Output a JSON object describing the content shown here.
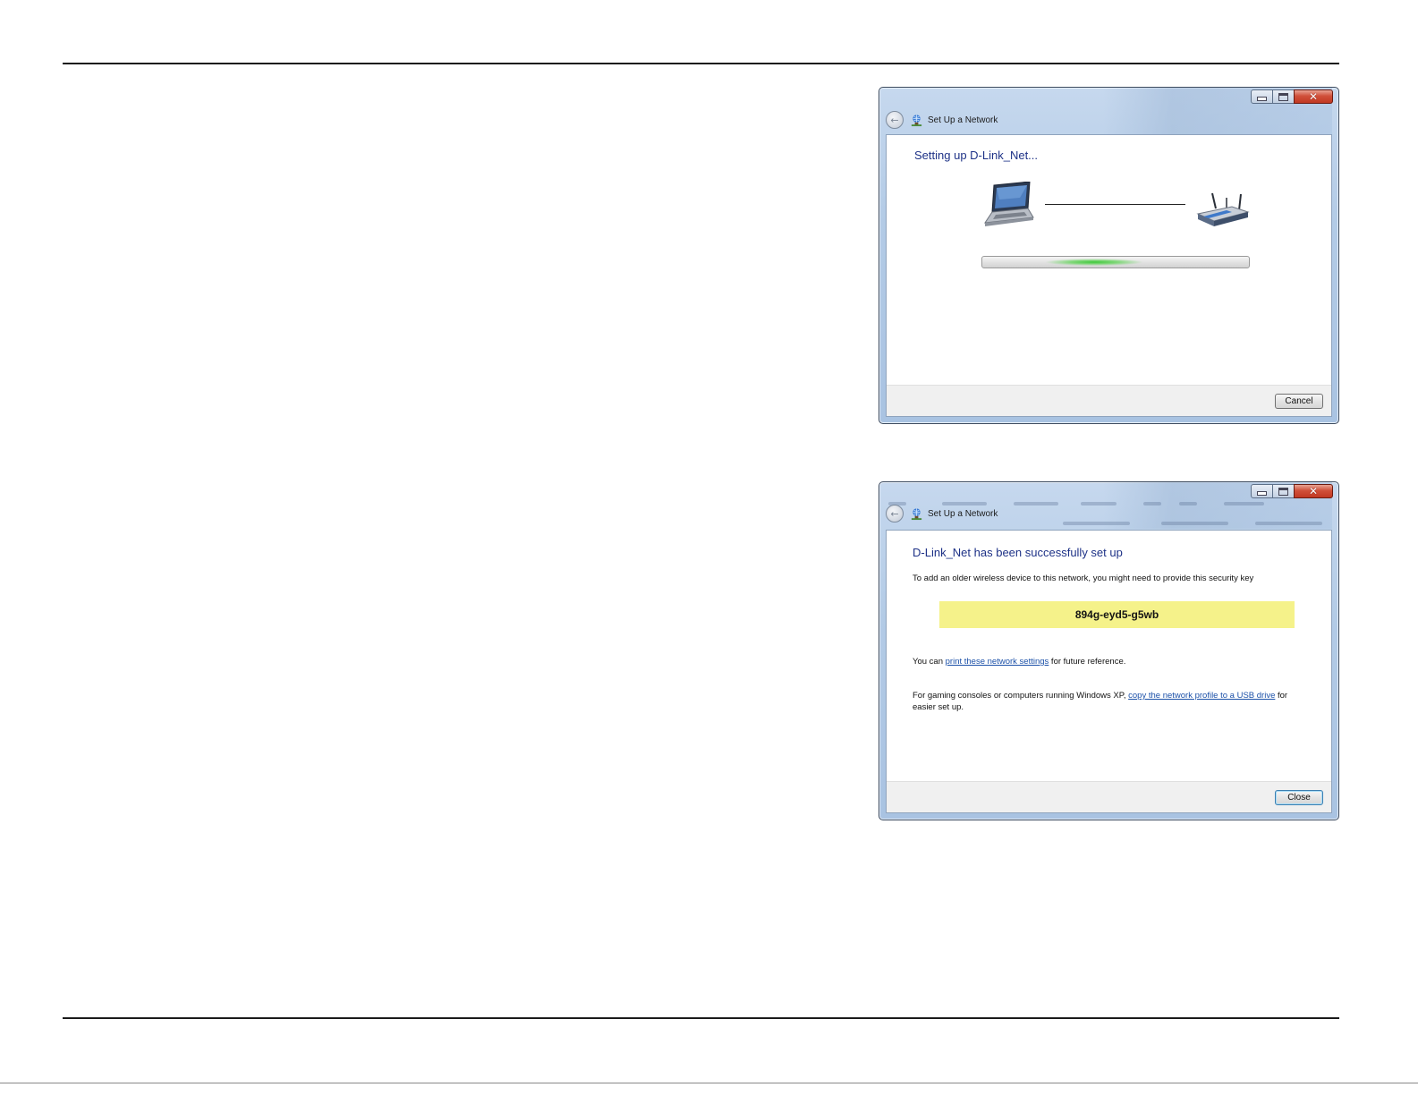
{
  "dialog_setting_up": {
    "window_title": "Set Up a Network",
    "heading": "Setting up D-Link_Net...",
    "cancel_label": "Cancel"
  },
  "dialog_success": {
    "window_title": "Set Up a Network",
    "heading": "D-Link_Net has been successfully set up",
    "instruction": "To add an older wireless device to this network, you might need to provide this security key",
    "security_key": "894g-eyd5-g5wb",
    "print_prefix": "You can ",
    "print_link": "print these network settings",
    "print_suffix": " for future reference.",
    "usb_prefix": "For gaming consoles or computers running Windows XP, ",
    "usb_link": "copy the network profile to a USB drive",
    "usb_suffix": " for easier set up.",
    "close_label": "Close"
  },
  "icons": {
    "minimize": "minimize-icon",
    "maximize": "maximize-icon",
    "close": "close-x-icon",
    "back": "back-arrow-icon",
    "network": "network-setup-icon",
    "laptop": "laptop-icon",
    "router": "wireless-router-icon"
  },
  "colors": {
    "heading_blue": "#1e3287",
    "link_blue": "#1b50a8",
    "key_highlight": "#f5f28a",
    "progress_green": "#3ec83a"
  }
}
